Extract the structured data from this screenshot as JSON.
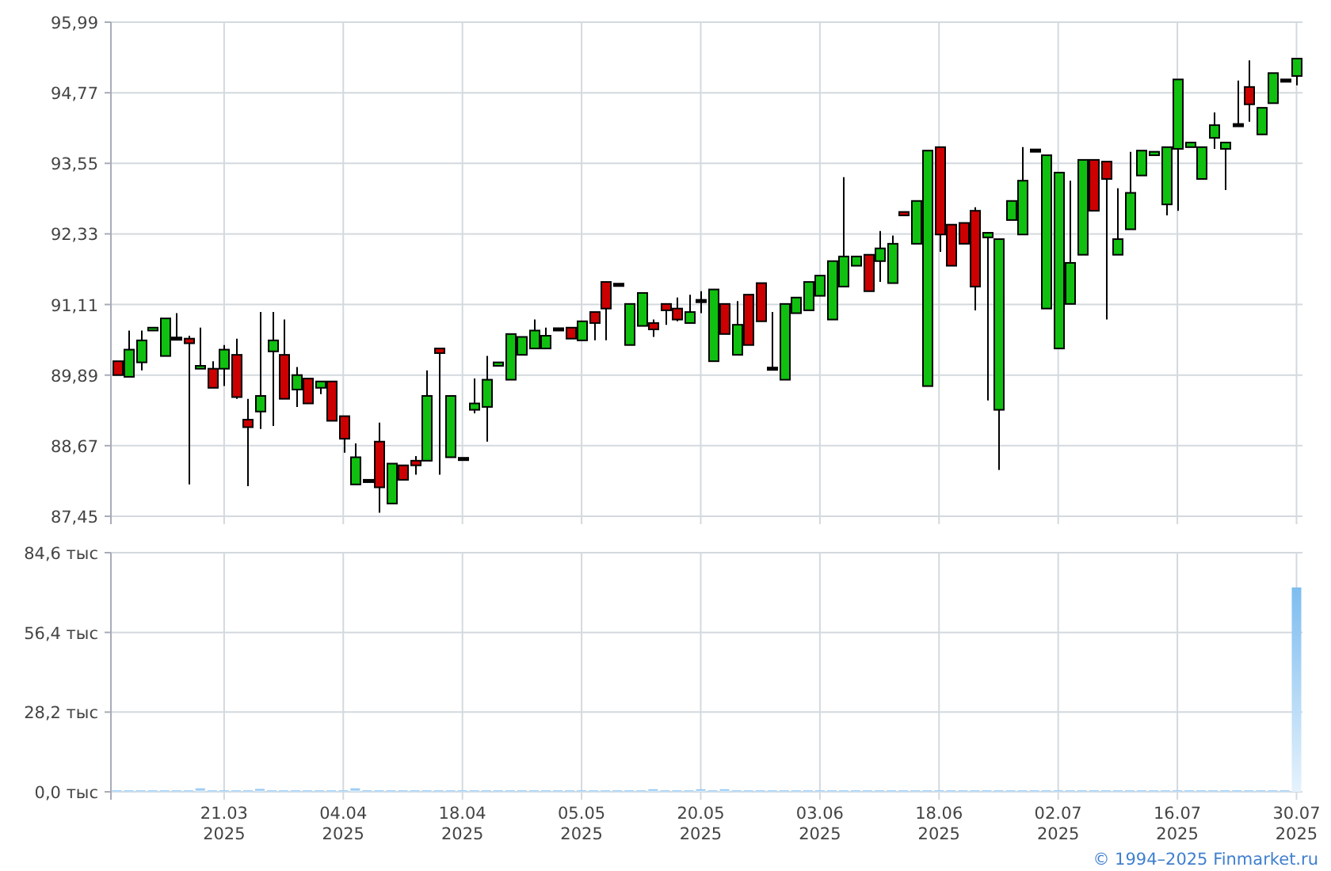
{
  "price_chart": {
    "chart_data": {
      "type": "candlestick",
      "grid": true,
      "categories": [
        null,
        null,
        null,
        null,
        null,
        null,
        null,
        null,
        null,
        null,
        null,
        null,
        null,
        null,
        null,
        null,
        null,
        null,
        null,
        null,
        null,
        null,
        null,
        null,
        null,
        null,
        null,
        null,
        null,
        null,
        null,
        null,
        null,
        null,
        null,
        null,
        null,
        null,
        null,
        null,
        null,
        null,
        null,
        null,
        null,
        null,
        null,
        null,
        null,
        null,
        null,
        null,
        null,
        null,
        null,
        null,
        null,
        null,
        null,
        null,
        null,
        null,
        null,
        null,
        null,
        null,
        null,
        null,
        null,
        null,
        null,
        null,
        null,
        null,
        null,
        null,
        null,
        null,
        null,
        null,
        null,
        null,
        null,
        null,
        null,
        null,
        null,
        null,
        null,
        null,
        null,
        null,
        null,
        null,
        null,
        null,
        null,
        null,
        null,
        null
      ],
      "ohlc": [
        [
          90.13,
          90.13,
          89.89,
          89.89
        ],
        [
          89.86,
          90.66,
          89.86,
          90.33
        ],
        [
          90.11,
          90.66,
          89.97,
          90.49
        ],
        [
          90.66,
          90.71,
          90.66,
          90.71
        ],
        [
          90.22,
          90.87,
          90.22,
          90.87
        ],
        [
          90.52,
          90.96,
          90.49,
          90.52
        ],
        [
          90.52,
          90.57,
          88.0,
          90.44
        ],
        [
          90.0,
          90.71,
          90.0,
          90.05
        ],
        [
          90.0,
          90.13,
          89.67,
          89.67
        ],
        [
          90.0,
          90.41,
          89.7,
          90.33
        ],
        [
          90.24,
          90.52,
          89.48,
          89.51
        ],
        [
          89.12,
          89.48,
          87.97,
          88.99
        ],
        [
          89.26,
          90.98,
          88.96,
          89.53
        ],
        [
          90.3,
          90.98,
          89.01,
          90.49
        ],
        [
          90.24,
          90.85,
          89.48,
          89.48
        ],
        [
          89.64,
          90.03,
          89.34,
          89.89
        ],
        [
          89.83,
          89.83,
          89.4,
          89.4
        ],
        [
          89.67,
          89.78,
          89.56,
          89.78
        ],
        [
          89.78,
          89.78,
          89.1,
          89.1
        ],
        [
          89.18,
          89.18,
          88.55,
          88.79
        ],
        [
          88.0,
          88.71,
          88.0,
          88.47
        ],
        [
          88.06,
          88.06,
          88.06,
          88.06
        ],
        [
          88.74,
          89.07,
          87.51,
          87.95
        ],
        [
          87.67,
          88.36,
          87.67,
          88.36
        ],
        [
          88.33,
          88.33,
          88.08,
          88.08
        ],
        [
          88.41,
          88.49,
          88.17,
          88.33
        ],
        [
          88.41,
          89.97,
          88.41,
          89.53
        ],
        [
          90.35,
          90.35,
          88.17,
          90.27
        ],
        [
          88.47,
          89.53,
          88.47,
          89.53
        ],
        [
          88.44,
          88.44,
          88.44,
          88.44
        ],
        [
          89.29,
          89.83,
          89.23,
          89.4
        ],
        [
          89.34,
          90.22,
          88.74,
          89.81
        ],
        [
          90.05,
          90.11,
          90.05,
          90.11
        ],
        [
          89.81,
          90.6,
          89.81,
          90.6
        ],
        [
          90.24,
          90.55,
          90.24,
          90.55
        ],
        [
          90.35,
          90.85,
          90.35,
          90.66
        ],
        [
          90.35,
          90.71,
          90.35,
          90.57
        ],
        [
          90.68,
          90.68,
          90.68,
          90.68
        ],
        [
          90.71,
          90.71,
          90.52,
          90.52
        ],
        [
          90.49,
          90.82,
          90.49,
          90.82
        ],
        [
          90.98,
          90.98,
          90.49,
          90.79
        ],
        [
          91.5,
          91.5,
          90.49,
          91.04
        ],
        [
          91.45,
          91.45,
          91.45,
          91.45
        ],
        [
          90.41,
          91.12,
          90.41,
          91.12
        ],
        [
          90.74,
          91.31,
          90.74,
          91.31
        ],
        [
          90.79,
          90.85,
          90.55,
          90.68
        ],
        [
          91.12,
          91.12,
          90.76,
          91.01
        ],
        [
          91.04,
          91.23,
          90.82,
          90.85
        ],
        [
          90.79,
          91.28,
          90.79,
          90.98
        ],
        [
          91.17,
          91.34,
          90.96,
          91.17
        ],
        [
          90.13,
          91.37,
          90.13,
          91.37
        ],
        [
          91.12,
          91.12,
          90.6,
          90.6
        ],
        [
          90.24,
          91.17,
          90.24,
          90.76
        ],
        [
          91.28,
          91.28,
          90.41,
          90.41
        ],
        [
          91.48,
          91.48,
          90.82,
          90.82
        ],
        [
          90.0,
          90.98,
          90.0,
          90.0
        ],
        [
          89.81,
          91.12,
          89.81,
          91.12
        ],
        [
          90.96,
          91.23,
          90.96,
          91.23
        ],
        [
          91.01,
          91.5,
          91.01,
          91.5
        ],
        [
          91.26,
          91.61,
          91.26,
          91.61
        ],
        [
          90.85,
          91.86,
          90.85,
          91.86
        ],
        [
          91.42,
          93.31,
          91.42,
          91.94
        ],
        [
          91.78,
          91.94,
          91.78,
          91.94
        ],
        [
          91.97,
          91.97,
          91.34,
          91.34
        ],
        [
          91.86,
          92.38,
          91.5,
          92.08
        ],
        [
          91.48,
          92.3,
          91.48,
          92.16
        ],
        [
          92.71,
          92.71,
          92.65,
          92.65
        ],
        [
          92.16,
          92.9,
          92.16,
          92.9
        ],
        [
          89.7,
          93.77,
          89.7,
          93.77
        ],
        [
          93.83,
          93.83,
          92.02,
          92.32
        ],
        [
          92.49,
          92.49,
          91.78,
          91.78
        ],
        [
          92.52,
          92.52,
          92.16,
          92.16
        ],
        [
          92.73,
          92.79,
          91.01,
          91.42
        ],
        [
          92.27,
          92.35,
          89.45,
          92.35
        ],
        [
          89.29,
          92.24,
          88.25,
          92.24
        ],
        [
          92.57,
          92.9,
          92.57,
          92.9
        ],
        [
          92.32,
          93.83,
          92.32,
          93.25
        ],
        [
          93.77,
          93.77,
          93.77,
          93.77
        ],
        [
          91.04,
          93.69,
          91.04,
          93.69
        ],
        [
          90.35,
          93.39,
          90.35,
          93.39
        ],
        [
          91.12,
          93.25,
          91.12,
          91.83
        ],
        [
          91.97,
          93.61,
          91.97,
          93.61
        ],
        [
          93.61,
          93.61,
          92.73,
          92.73
        ],
        [
          93.58,
          93.58,
          90.85,
          93.28
        ],
        [
          91.97,
          93.12,
          91.97,
          92.24
        ],
        [
          92.41,
          93.75,
          92.41,
          93.04
        ],
        [
          93.34,
          93.77,
          93.34,
          93.77
        ],
        [
          93.69,
          93.75,
          93.69,
          93.75
        ],
        [
          92.84,
          93.83,
          92.65,
          93.83
        ],
        [
          93.8,
          95.0,
          92.73,
          95.0
        ],
        [
          93.83,
          93.91,
          93.83,
          93.91
        ],
        [
          93.28,
          93.83,
          93.28,
          93.83
        ],
        [
          93.99,
          94.43,
          93.8,
          94.21
        ],
        [
          93.8,
          93.91,
          93.09,
          93.91
        ],
        [
          94.21,
          94.98,
          94.21,
          94.21
        ],
        [
          94.87,
          95.33,
          94.27,
          94.57
        ],
        [
          94.05,
          94.51,
          94.05,
          94.51
        ],
        [
          94.59,
          95.11,
          94.59,
          95.11
        ],
        [
          94.98,
          94.98,
          94.98,
          94.98
        ],
        [
          95.06,
          95.36,
          94.9,
          95.36
        ]
      ],
      "ylim": [
        87.45,
        95.99
      ],
      "yticks": [
        {
          "value": 95.99,
          "label": "95,99"
        },
        {
          "value": 94.77,
          "label": "94,77"
        },
        {
          "value": 93.55,
          "label": "93,55"
        },
        {
          "value": 92.33,
          "label": "92,33"
        },
        {
          "value": 91.11,
          "label": "91,11"
        },
        {
          "value": 89.89,
          "label": "89,89"
        },
        {
          "value": 88.67,
          "label": "88,67"
        },
        {
          "value": 87.45,
          "label": "87,45"
        }
      ]
    }
  },
  "volume_chart": {
    "chart_data": {
      "type": "bar",
      "grid": true,
      "categories": [
        null,
        null,
        null,
        null,
        null,
        null,
        null,
        null,
        null,
        "21.03 2025",
        null,
        null,
        null,
        null,
        null,
        null,
        null,
        null,
        null,
        "04.04 2025",
        null,
        null,
        null,
        null,
        null,
        null,
        null,
        null,
        null,
        "18.04 2025",
        null,
        null,
        null,
        null,
        null,
        null,
        null,
        null,
        null,
        "05.05 2025",
        null,
        null,
        null,
        null,
        null,
        null,
        null,
        null,
        null,
        "20.05 2025",
        null,
        null,
        null,
        null,
        null,
        null,
        null,
        null,
        null,
        "03.06 2025",
        null,
        null,
        null,
        null,
        null,
        null,
        null,
        null,
        null,
        "18.06 2025",
        null,
        null,
        null,
        null,
        null,
        null,
        null,
        null,
        null,
        "02.07 2025",
        null,
        null,
        null,
        null,
        null,
        null,
        null,
        null,
        null,
        "16.07 2025",
        null,
        null,
        null,
        null,
        null,
        null,
        null,
        null,
        null,
        "30.07 2025"
      ],
      "series": [
        {
          "color": "#7dbdf0",
          "values": [
            0.5,
            0.5,
            0.5,
            0.5,
            0.5,
            0.5,
            0.5,
            1.2,
            0.5,
            0.5,
            0.5,
            0.5,
            1.0,
            0.5,
            0.5,
            0.5,
            0.5,
            0.5,
            0.5,
            0.5,
            1.2,
            0.5,
            0.5,
            0.5,
            0.5,
            0.5,
            0.5,
            0.5,
            0.5,
            0.5,
            0.5,
            0.5,
            0.5,
            0.5,
            0.5,
            0.5,
            0.5,
            0.5,
            0.5,
            0.5,
            0.5,
            0.5,
            0.5,
            0.5,
            0.5,
            0.9,
            0.5,
            0.5,
            0.5,
            0.9,
            0.5,
            0.9,
            0.5,
            0.5,
            0.5,
            0.5,
            0.5,
            0.5,
            0.5,
            0.5,
            0.5,
            0.5,
            0.5,
            0.5,
            0.5,
            0.5,
            0.5,
            0.5,
            0.5,
            0.5,
            0.5,
            0.5,
            0.5,
            0.5,
            0.5,
            0.5,
            0.5,
            0.5,
            0.5,
            0.5,
            0.5,
            0.5,
            0.5,
            0.5,
            0.5,
            0.5,
            0.5,
            0.5,
            0.5,
            0.5,
            0.5,
            0.5,
            0.5,
            0.5,
            0.5,
            0.5,
            0.5,
            0.5,
            0.5,
            72.3
          ]
        }
      ],
      "ylim": [
        0,
        84.6
      ],
      "yticks": [
        {
          "value": 84.6,
          "label": "84,6 тыс"
        },
        {
          "value": 56.4,
          "label": "56,4 тыс"
        },
        {
          "value": 28.2,
          "label": "28,2 тыс"
        },
        {
          "value": 0,
          "label": "0,0 тыс"
        }
      ]
    }
  },
  "copyright": "© 1994–2025 Finmarket.ru"
}
